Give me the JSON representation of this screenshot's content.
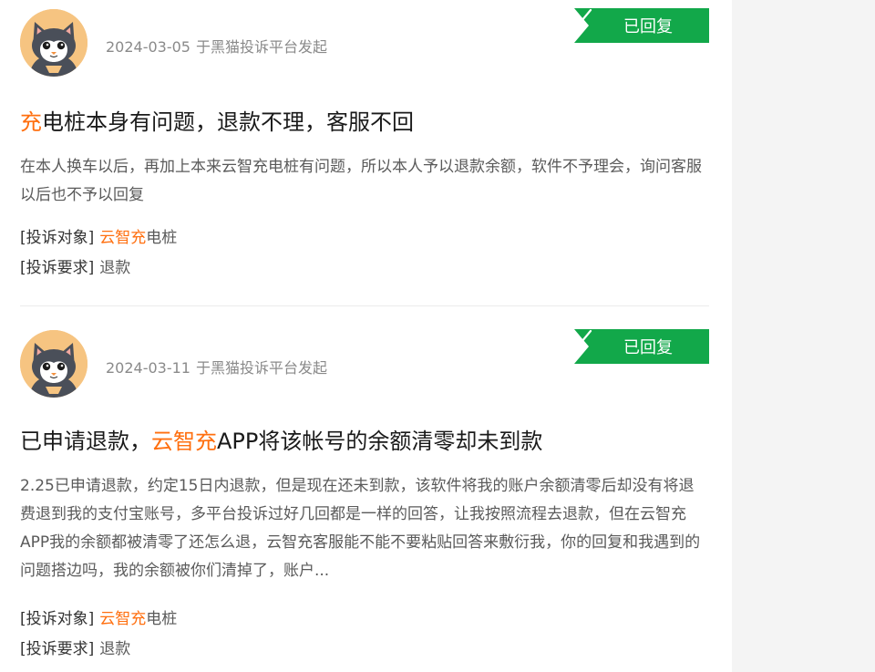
{
  "complaints": [
    {
      "date": "2024-03-05",
      "source": "于黑猫投诉平台发起",
      "status": "已回复",
      "title_highlight": "充",
      "title_rest": "电桩本身有问题，退款不理，客服不回",
      "content": "在本人换车以后，再加上本来云智充电桩有问题，所以本人予以退款余额，软件不予理会，询问客服以后也不予以回复",
      "target_label": "[投诉对象]",
      "target_highlight": "云智充",
      "target_rest": "电桩",
      "demand_label": "[投诉要求]",
      "demand_value": "退款"
    },
    {
      "date": "2024-03-11",
      "source": "于黑猫投诉平台发起",
      "status": "已回复",
      "title_pre": "已申请退款，",
      "title_highlight": "云智充",
      "title_rest": "APP将该帐号的余额清零却未到款",
      "content": "2.25已申请退款，约定15日内退款，但是现在还未到款，该软件将我的账户余额清零后却没有将退费退到我的支付宝账号，多平台投诉过好几回都是一样的回答，让我按照流程去退款，但在云智充APP我的余额都被清零了还怎么退，云智充客服能不能不要粘贴回答来敷衍我，你的回复和我遇到的问题搭边吗，我的余额被你们清掉了，账户...",
      "target_label": "[投诉对象]",
      "target_highlight": "云智充",
      "target_rest": "电桩",
      "demand_label": "[投诉要求]",
      "demand_value": "退款"
    }
  ],
  "colors": {
    "accent_orange": "#ff6f0f",
    "badge_green": "#12a84a",
    "avatar_bg": "#f6c481"
  },
  "icons": {
    "avatar": "black-cat-avatar-icon",
    "badge_check": "checkmark-icon"
  }
}
